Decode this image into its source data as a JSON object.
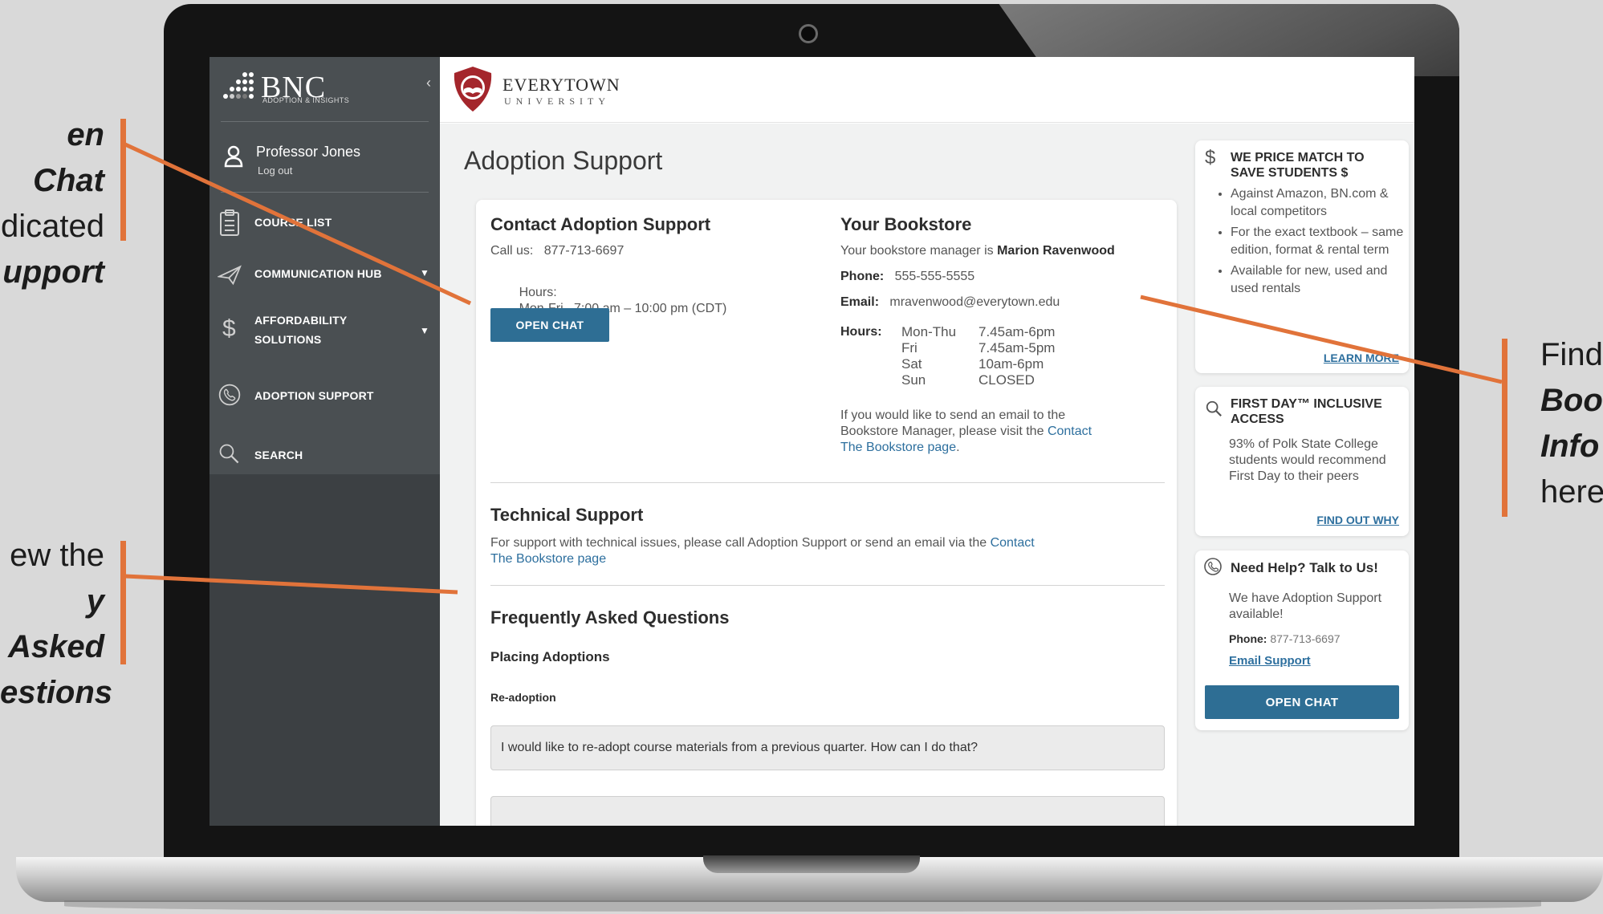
{
  "annotations": {
    "open_chat": [
      "en Chat",
      "dicated",
      "upport"
    ],
    "faq": [
      "ew the",
      "y Asked",
      "estions"
    ],
    "bookstore": [
      "Find",
      "Boo",
      "Info",
      "here"
    ]
  },
  "sidebar": {
    "brand_name": "BNC",
    "brand_sub": "ADOPTION & INSIGHTS",
    "collapse_icon": "chevron-left",
    "user_name": "Professor Jones",
    "logout": "Log out",
    "items": [
      {
        "label": "COURSE LIST",
        "icon": "clipboard-icon"
      },
      {
        "label": "COMMUNICATION HUB",
        "icon": "paper-plane-icon",
        "has_caret": true
      },
      {
        "label": "AFFORDABILITY",
        "label2": "SOLUTIONS",
        "icon": "dollar-icon",
        "has_caret": true
      },
      {
        "label": "ADOPTION SUPPORT",
        "icon": "phone-icon"
      },
      {
        "label": "SEARCH",
        "icon": "search-icon"
      }
    ]
  },
  "header": {
    "university_name": "EVERYTOWN",
    "university_sub": "UNIVERSITY"
  },
  "main": {
    "page_title": "Adoption Support",
    "contact": {
      "heading": "Contact Adoption Support",
      "call_label": "Call us:",
      "call_value": "877-713-6697",
      "hours_label": "Hours:",
      "hours_value": "Mon-Fri   7:00 am – 10:00 pm (CDT)",
      "open_chat": "OPEN CHAT"
    },
    "bookstore": {
      "heading": "Your Bookstore",
      "manager_prefix": "Your bookstore manager is",
      "manager_name": "Marion Ravenwood",
      "phone_label": "Phone:",
      "phone_value": "555-555-5555",
      "email_label": "Email:",
      "email_value": "mravenwood@everytown.edu",
      "hours_label": "Hours:",
      "hours": [
        {
          "day": "Mon-Thu",
          "time": "7.45am-6pm"
        },
        {
          "day": "Fri",
          "time": "7.45am-5pm"
        },
        {
          "day": "Sat",
          "time": "10am-6pm"
        },
        {
          "day": "Sun",
          "time": "CLOSED"
        }
      ],
      "email_note_line1": "If you would like to send an email to the",
      "email_note_line2_prefix": "Bookstore Manager, please visit the",
      "email_note_link1": "Contact",
      "email_note_link2": "The Bookstore page",
      "email_note_end": "."
    },
    "technical": {
      "heading": "Technical Support",
      "text": "For support with technical issues, please call Adoption Support or send an email via the",
      "link1": "Contact",
      "link2": "The Bookstore page"
    },
    "faq": {
      "heading": "Frequently Asked Questions",
      "section": "Placing Adoptions",
      "subsection": "Re-adoption",
      "questions": [
        "I would like to re-adopt course materials from a previous quarter. How can I do that?"
      ]
    }
  },
  "promos": {
    "price_match": {
      "title_line1": "WE PRICE MATCH TO",
      "title_line2": "SAVE STUDENTS $",
      "bullets": [
        "Against Amazon, BN.com & local competitors",
        "For the exact textbook – same edition, format & rental term",
        "Available for new, used and used rentals"
      ],
      "link": "LEARN MORE"
    },
    "first_day": {
      "title_line1": "FIRST DAY™ INCLUSIVE",
      "title_line2": "ACCESS",
      "text": "93% of Polk State College students would recommend First Day to their peers",
      "link": "FIND OUT WHY"
    },
    "help": {
      "title": "Need Help? Talk to Us!",
      "text": "We have Adoption Support available!",
      "phone_label": "Phone:",
      "phone_value": "877-713-6697",
      "email_link": "Email Support",
      "open_chat": "OPEN CHAT"
    }
  },
  "colors": {
    "accent": "#2e6e94",
    "callout": "#e1733a",
    "sidebar": "#4a4f52",
    "university_red": "#a4262c"
  }
}
